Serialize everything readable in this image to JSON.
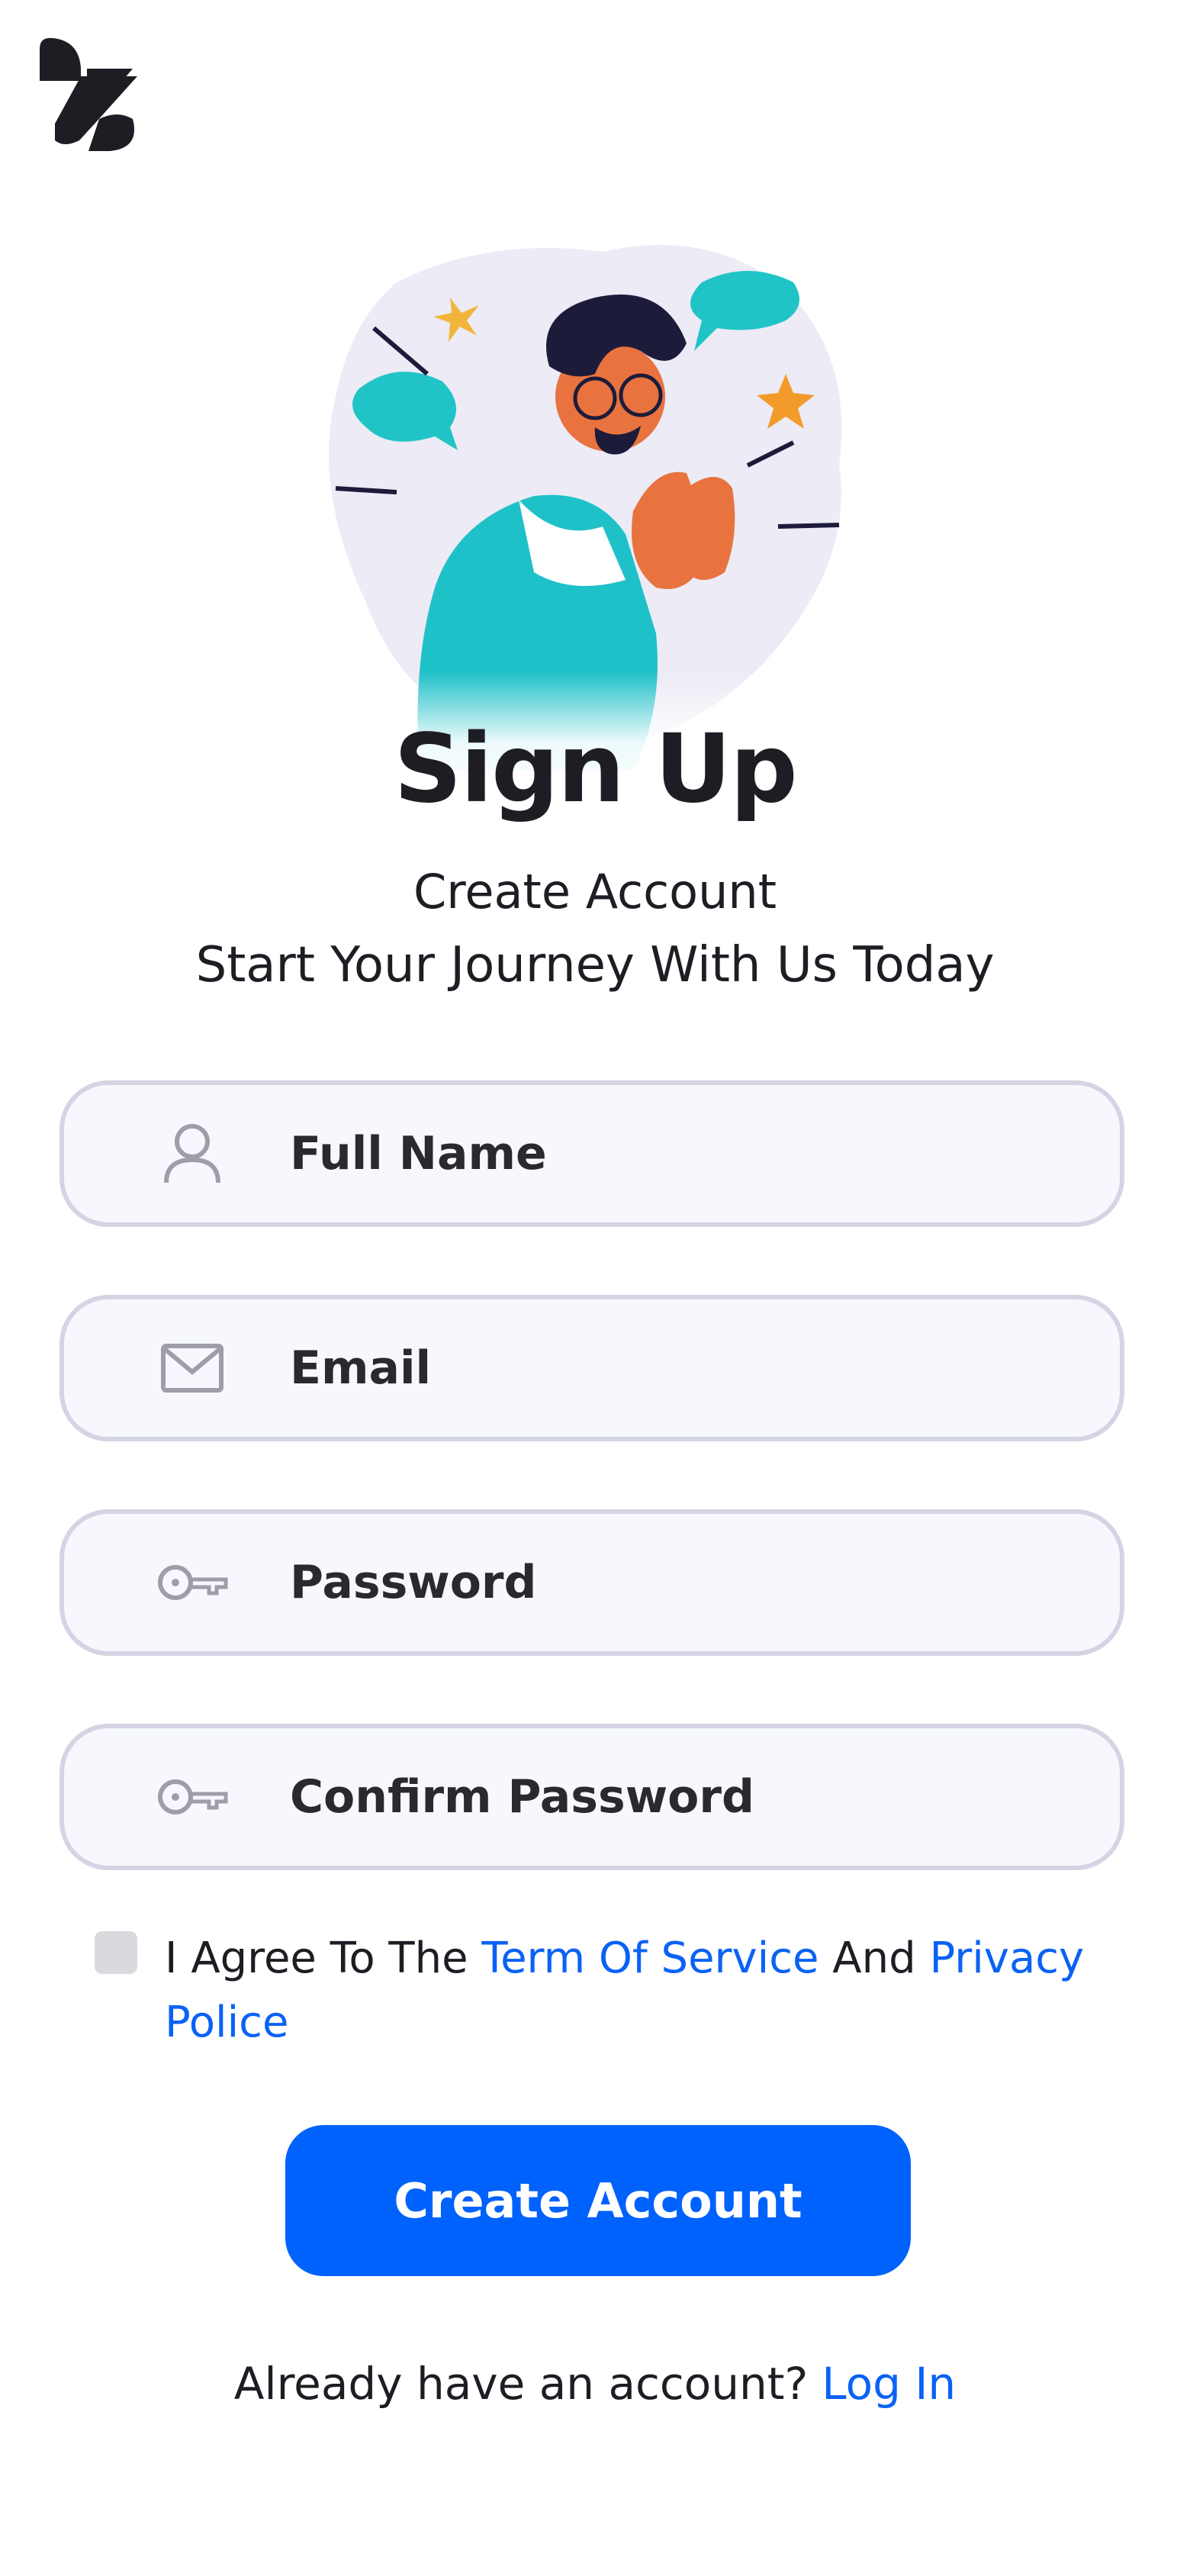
{
  "header": {
    "logo_icon": "brand-logo-icon"
  },
  "hero": {
    "illustration": "excited-person-clapping-illustration"
  },
  "heading": {
    "title": "Sign Up",
    "subtitle": "Create Account",
    "tagline": "Start Your Journey With Us Today"
  },
  "form": {
    "full_name": {
      "placeholder": "Full Name",
      "value": "",
      "icon": "user-icon"
    },
    "email": {
      "placeholder": "Email",
      "value": "",
      "icon": "mail-icon"
    },
    "password": {
      "placeholder": "Password",
      "value": "",
      "icon": "key-icon"
    },
    "confirm_password": {
      "placeholder": "Confirm Password",
      "value": "",
      "icon": "key-icon"
    }
  },
  "agreement": {
    "checked": false,
    "prefix": "I Agree To The ",
    "terms_link": "Term Of Service",
    "middle": " And ",
    "privacy_link": "Privacy Police"
  },
  "submit_label": "Create Account",
  "footer": {
    "prompt": "Already have an account?",
    "login_link": "Log In"
  },
  "colors": {
    "accent": "#0062fc",
    "link": "#0a62f5",
    "field_bg": "#f6f8fd",
    "field_border": "#d4d4e4",
    "text": "#1f1d24"
  }
}
